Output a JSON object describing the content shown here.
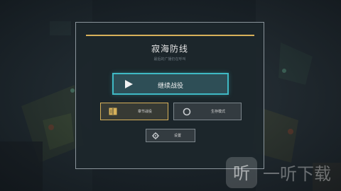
{
  "menu": {
    "title": "寂海防线",
    "subtitle": "最后的广播仍在呼叫",
    "continue_label": "继续战役",
    "story_label": "章节战役",
    "survival_label": "生存模式",
    "settings_label": "设置"
  },
  "icons": {
    "continue": "play-icon",
    "story": "book-icon",
    "survival": "ring-icon",
    "settings": "gear-icon"
  },
  "watermark": {
    "text": "一听下载"
  },
  "colors": {
    "accent_gold": "#d7b15a",
    "accent_cyan": "#3fb9c4",
    "panel_bg": "#1d262c"
  }
}
